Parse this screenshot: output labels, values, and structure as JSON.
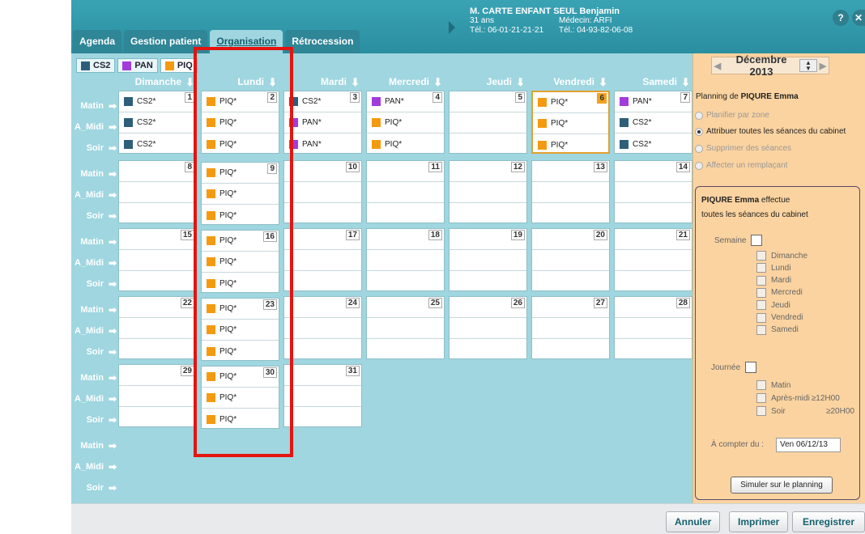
{
  "tabs": [
    {
      "label": "Agenda",
      "active": false
    },
    {
      "label": "Gestion patient",
      "active": false
    },
    {
      "label": "Organisation",
      "active": true
    },
    {
      "label": "Rétrocession",
      "active": false
    }
  ],
  "patient": {
    "name": "M. CARTE ENFANT SEUL Benjamin",
    "age": "31 ans",
    "doctor": "Médecin: ARFI",
    "phone1": "Tél.: 06-01-21-21-21",
    "phone2": "Tél.: 04-93-82-06-08"
  },
  "header_buttons": {
    "help": "?",
    "close": "✕"
  },
  "layer_tabs": [
    {
      "label": "CS2",
      "color": "#2d5f7a"
    },
    {
      "label": "PAN",
      "color": "#a23bdc"
    },
    {
      "label": "PIQ",
      "color": "#f49a10"
    }
  ],
  "days": [
    "Dimanche",
    "Lundi",
    "Mardi",
    "Mercredi",
    "Jeudi",
    "Vendredi",
    "Samedi"
  ],
  "slots": [
    "Matin",
    "A_Midi",
    "Soir"
  ],
  "weeks": [
    [
      {
        "num": "1",
        "cells": [
          {
            "t": "CS2*",
            "c": "#2d5f7a"
          },
          {
            "t": "CS2*",
            "c": "#2d5f7a"
          },
          {
            "t": "CS2*",
            "c": "#2d5f7a"
          }
        ]
      },
      {
        "num": "2",
        "cells": [
          {
            "t": "PIQ*",
            "c": "#f49a10"
          },
          {
            "t": "PIQ*",
            "c": "#f49a10"
          },
          {
            "t": "PIQ*",
            "c": "#f49a10"
          }
        ]
      },
      {
        "num": "3",
        "cells": [
          {
            "t": "CS2*",
            "c": "#2d5f7a"
          },
          {
            "t": "PAN*",
            "c": "#a23bdc"
          },
          {
            "t": "PAN*",
            "c": "#a23bdc"
          }
        ]
      },
      {
        "num": "4",
        "cells": [
          {
            "t": "PAN*",
            "c": "#a23bdc"
          },
          {
            "t": "PIQ*",
            "c": "#f49a10"
          },
          {
            "t": "PIQ*",
            "c": "#f49a10"
          }
        ]
      },
      {
        "num": "5",
        "cells": [
          {
            "t": "",
            "c": ""
          },
          {
            "t": "",
            "c": ""
          },
          {
            "t": "",
            "c": ""
          }
        ]
      },
      {
        "num": "6",
        "hl": true,
        "cells": [
          {
            "t": "PIQ*",
            "c": "#f49a10"
          },
          {
            "t": "PIQ*",
            "c": "#f49a10"
          },
          {
            "t": "PIQ*",
            "c": "#f49a10"
          }
        ]
      },
      {
        "num": "7",
        "cells": [
          {
            "t": "PAN*",
            "c": "#a23bdc"
          },
          {
            "t": "CS2*",
            "c": "#2d5f7a"
          },
          {
            "t": "CS2*",
            "c": "#2d5f7a"
          }
        ]
      }
    ],
    [
      {
        "num": "8",
        "cells": []
      },
      {
        "num": "9",
        "cells": [
          {
            "t": "PIQ*",
            "c": "#f49a10"
          },
          {
            "t": "PIQ*",
            "c": "#f49a10"
          },
          {
            "t": "PIQ*",
            "c": "#f49a10"
          }
        ]
      },
      {
        "num": "10",
        "cells": []
      },
      {
        "num": "11",
        "cells": []
      },
      {
        "num": "12",
        "cells": []
      },
      {
        "num": "13",
        "cells": []
      },
      {
        "num": "14",
        "cells": []
      }
    ],
    [
      {
        "num": "15",
        "cells": []
      },
      {
        "num": "16",
        "cells": [
          {
            "t": "PIQ*",
            "c": "#f49a10"
          },
          {
            "t": "PIQ*",
            "c": "#f49a10"
          },
          {
            "t": "PIQ*",
            "c": "#f49a10"
          }
        ]
      },
      {
        "num": "17",
        "cells": []
      },
      {
        "num": "18",
        "cells": []
      },
      {
        "num": "19",
        "cells": []
      },
      {
        "num": "20",
        "cells": []
      },
      {
        "num": "21",
        "cells": []
      }
    ],
    [
      {
        "num": "22",
        "cells": []
      },
      {
        "num": "23",
        "cells": [
          {
            "t": "PIQ*",
            "c": "#f49a10"
          },
          {
            "t": "PIQ*",
            "c": "#f49a10"
          },
          {
            "t": "PIQ*",
            "c": "#f49a10"
          }
        ]
      },
      {
        "num": "24",
        "cells": []
      },
      {
        "num": "25",
        "cells": []
      },
      {
        "num": "26",
        "cells": []
      },
      {
        "num": "27",
        "cells": []
      },
      {
        "num": "28",
        "cells": []
      }
    ],
    [
      {
        "num": "29",
        "cells": []
      },
      {
        "num": "30",
        "cells": [
          {
            "t": "PIQ*",
            "c": "#f49a10"
          },
          {
            "t": "PIQ*",
            "c": "#f49a10"
          },
          {
            "t": "PIQ*",
            "c": "#f49a10"
          }
        ]
      },
      {
        "num": "31",
        "cells": []
      }
    ]
  ],
  "panel": {
    "month": "Décembre 2013",
    "planning_prefix": "Planning de",
    "planning_name": "PIQURE Emma",
    "options": [
      {
        "label": "Planifier par zone",
        "on": false,
        "enabled": false
      },
      {
        "label": "Attribuer toutes les séances du cabinet",
        "on": true,
        "enabled": true
      },
      {
        "label": "Supprimer des séances",
        "on": false,
        "enabled": false
      },
      {
        "label": "Affecter un remplaçant",
        "on": false,
        "enabled": false
      }
    ],
    "effect_name": "PIQURE Emma",
    "effect_rest": "effectue",
    "effect_line2": "toutes les séances du cabinet",
    "semaine_label": "Semaine",
    "week_days": [
      "Dimanche",
      "Lundi",
      "Mardi",
      "Mercredi",
      "Jeudi",
      "Vendredi",
      "Samedi"
    ],
    "journee_label": "Journée",
    "day_parts": [
      {
        "label": "Matin",
        "extra": ""
      },
      {
        "label": "Après-midi",
        "extra": "≥12H00"
      },
      {
        "label": "Soir",
        "extra": "≥20H00"
      }
    ],
    "start_label": "À compter du :",
    "start_value": "Ven 06/12/13",
    "simulate_label": "Simuler sur le planning"
  },
  "footer": {
    "cancel": "Annuler",
    "print": "Imprimer",
    "save": "Enregistrer"
  },
  "colors": {
    "cs2": "#2d5f7a",
    "pan": "#a23bdc",
    "piq": "#f49a10",
    "highlight": "#e1a030",
    "annotation": "#e4140f"
  }
}
